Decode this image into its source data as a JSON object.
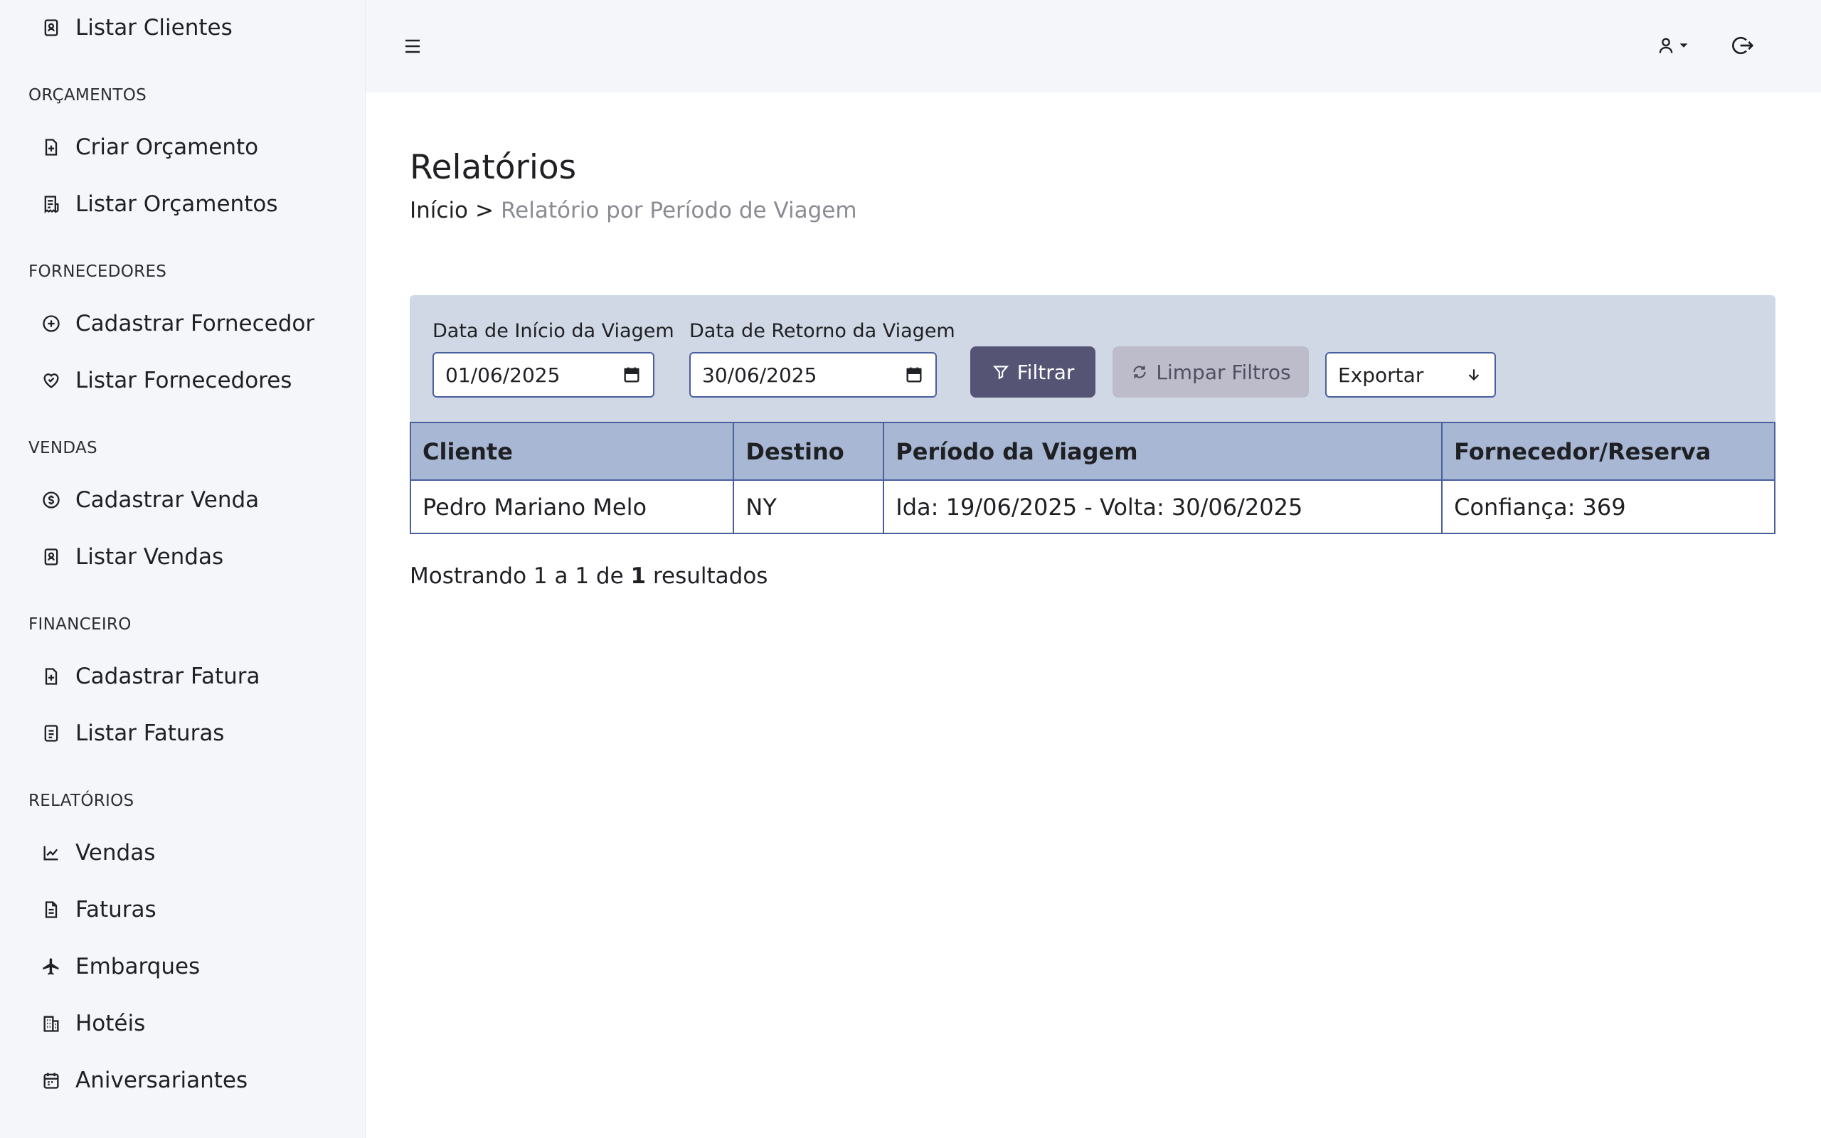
{
  "sidebar": {
    "items_top": [
      {
        "label": "Listar Clientes",
        "icon": "contact-card-icon"
      }
    ],
    "sections": [
      {
        "title": "ORÇAMENTOS",
        "items": [
          {
            "label": "Criar Orçamento",
            "icon": "file-plus-icon"
          },
          {
            "label": "Listar Orçamentos",
            "icon": "receipt-list-icon"
          }
        ]
      },
      {
        "title": "FORNECEDORES",
        "items": [
          {
            "label": "Cadastrar Fornecedor",
            "icon": "circle-plus-icon"
          },
          {
            "label": "Listar Fornecedores",
            "icon": "heart-handshake-icon"
          }
        ]
      },
      {
        "title": "VENDAS",
        "items": [
          {
            "label": "Cadastrar Venda",
            "icon": "coin-icon"
          },
          {
            "label": "Listar Vendas",
            "icon": "contact-card-icon"
          }
        ]
      },
      {
        "title": "FINANCEIRO",
        "items": [
          {
            "label": "Cadastrar Fatura",
            "icon": "file-plus-icon"
          },
          {
            "label": "Listar Faturas",
            "icon": "document-list-icon"
          }
        ]
      },
      {
        "title": "RELATÓRIOS",
        "items": [
          {
            "label": "Vendas",
            "icon": "line-chart-icon"
          },
          {
            "label": "Faturas",
            "icon": "document-icon"
          },
          {
            "label": "Embarques",
            "icon": "airplane-icon"
          },
          {
            "label": "Hotéis",
            "icon": "building-icon"
          },
          {
            "label": "Aniversariantes",
            "icon": "calendar-icon"
          }
        ]
      }
    ]
  },
  "topbar": {
    "menu_icon": "hamburger-icon",
    "user_icon": "user-icon",
    "logout_icon": "logout-icon"
  },
  "page": {
    "title": "Relatórios",
    "breadcrumb": {
      "home": "Início",
      "separator": ">",
      "current": "Relatório por Período de Viagem"
    }
  },
  "filters": {
    "start_label": "Data de Início da Viagem",
    "start_value": "01/06/2025",
    "end_label": "Data de Retorno da Viagem",
    "end_value": "30/06/2025",
    "filter_button": "Filtrar",
    "clear_button": "Limpar Filtros",
    "export_select": "Exportar"
  },
  "table": {
    "headers": [
      "Cliente",
      "Destino",
      "Período da Viagem",
      "Fornecedor/Reserva"
    ],
    "rows": [
      [
        "Pedro Mariano Melo",
        "NY",
        "Ida: 19/06/2025 - Volta: 30/06/2025",
        "Confiança: 369"
      ]
    ]
  },
  "results": {
    "prefix": "Mostrando 1 a 1 de",
    "total": "1",
    "suffix": "resultados"
  },
  "colors": {
    "sidebar_bg": "#f5f6f9",
    "filter_panel_bg": "#d0d8e6",
    "table_header_bg": "#a8b7d3",
    "table_border": "#4a5f9e",
    "primary_button": "#555475",
    "secondary_button": "#bcbccb",
    "breadcrumb_muted": "#8a8c92"
  }
}
